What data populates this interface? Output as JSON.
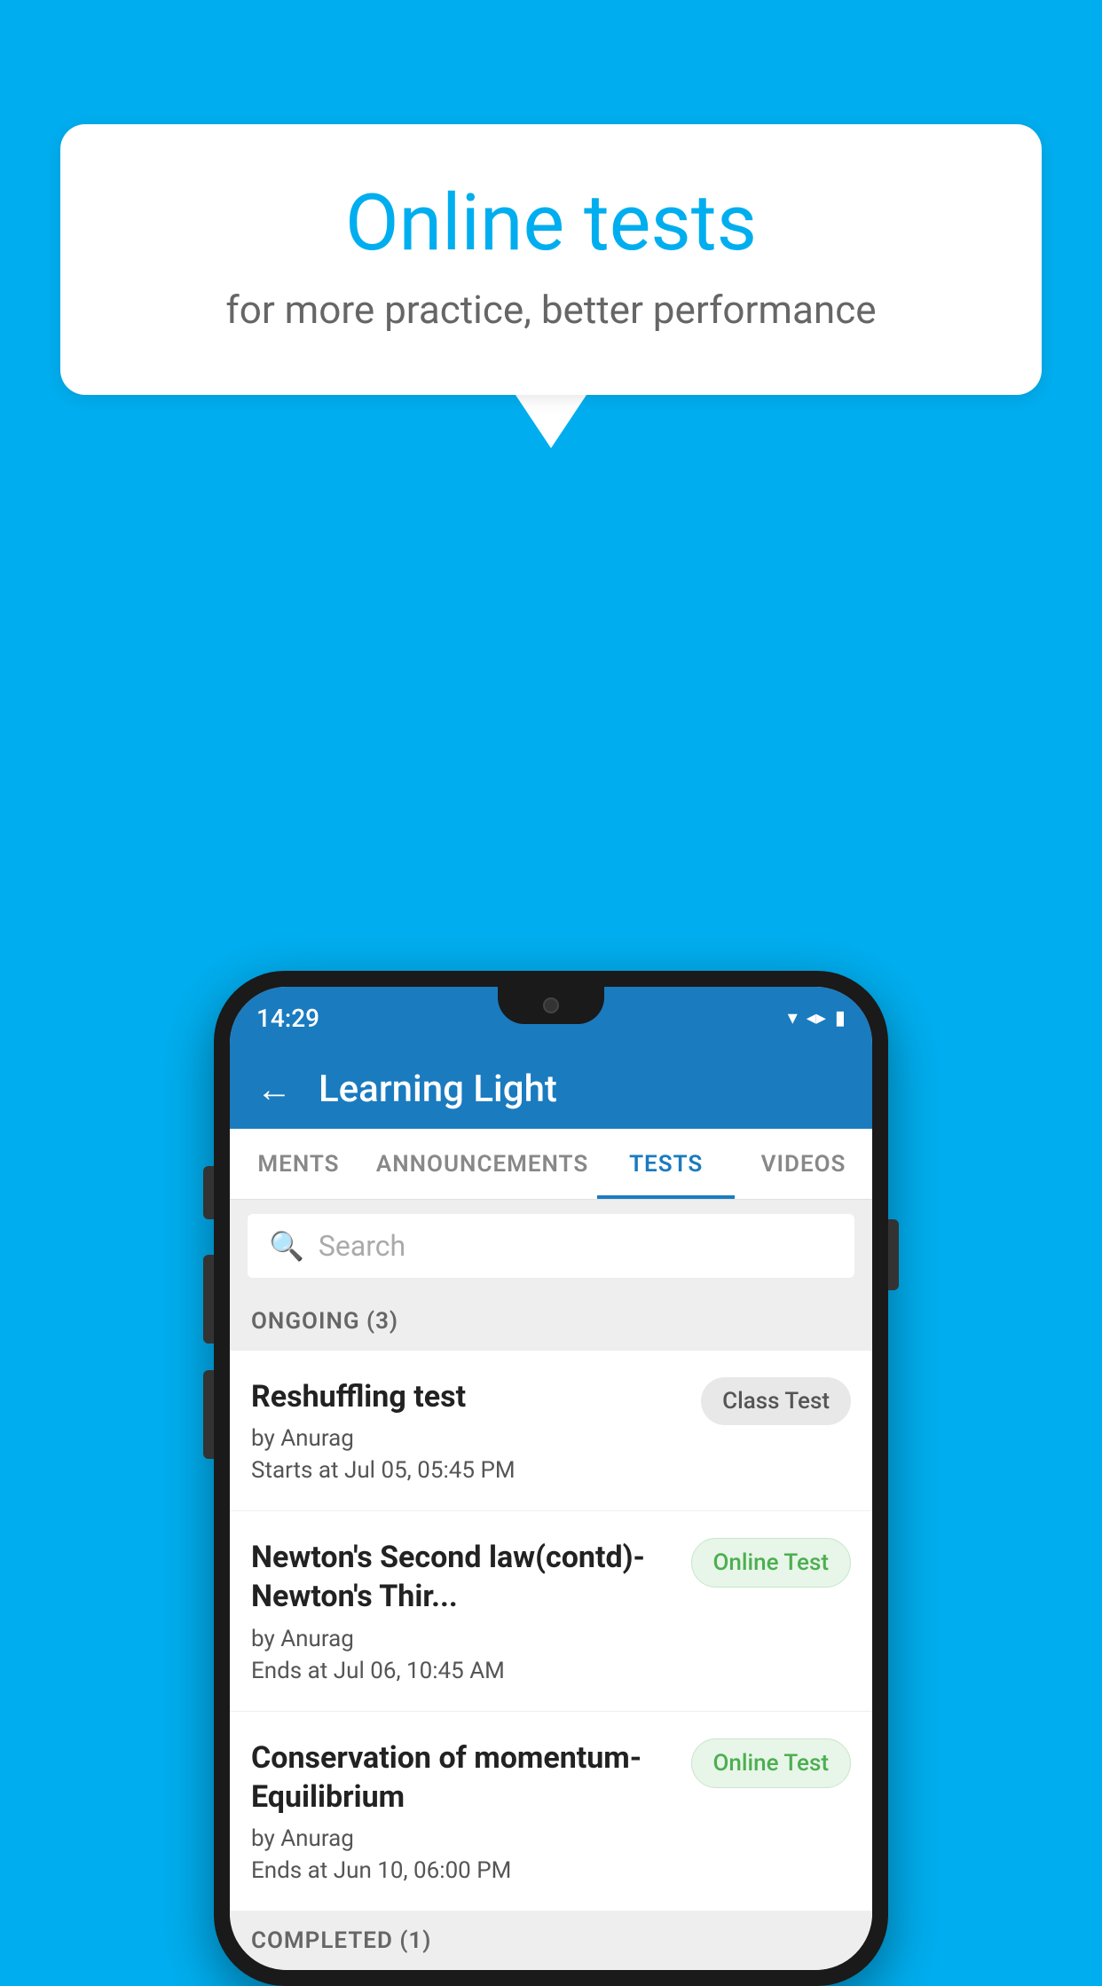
{
  "background": {
    "color": "#00AEEF"
  },
  "speech_bubble": {
    "title": "Online tests",
    "subtitle": "for more practice, better performance"
  },
  "phone": {
    "status_bar": {
      "time": "14:29",
      "icons": [
        "wifi",
        "signal",
        "battery"
      ]
    },
    "app_header": {
      "title": "Learning Light",
      "back_label": "←"
    },
    "tabs": [
      {
        "label": "MENTS",
        "active": false
      },
      {
        "label": "ANNOUNCEMENTS",
        "active": false
      },
      {
        "label": "TESTS",
        "active": true
      },
      {
        "label": "VIDEOS",
        "active": false
      }
    ],
    "search": {
      "placeholder": "Search"
    },
    "ongoing_section": {
      "label": "ONGOING (3)"
    },
    "tests": [
      {
        "name": "Reshuffling test",
        "author": "by Anurag",
        "date": "Starts at  Jul 05, 05:45 PM",
        "badge": "Class Test",
        "badge_type": "class"
      },
      {
        "name": "Newton's Second law(contd)-Newton's Thir...",
        "author": "by Anurag",
        "date": "Ends at  Jul 06, 10:45 AM",
        "badge": "Online Test",
        "badge_type": "online"
      },
      {
        "name": "Conservation of momentum-Equilibrium",
        "author": "by Anurag",
        "date": "Ends at  Jun 10, 06:00 PM",
        "badge": "Online Test",
        "badge_type": "online"
      }
    ],
    "completed_section": {
      "label": "COMPLETED (1)"
    }
  }
}
